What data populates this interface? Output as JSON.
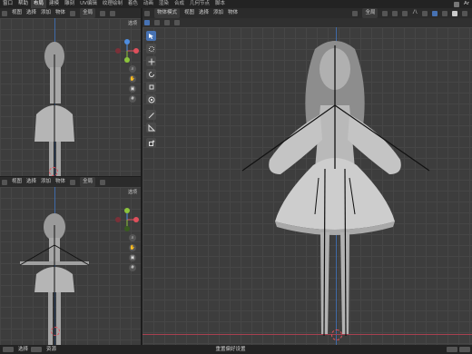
{
  "topbar": {
    "menus": [
      "窗口",
      "帮助"
    ],
    "workspaces": [
      "布局",
      "建模",
      "雕刻",
      "UV编辑",
      "纹理绘制",
      "着色",
      "动画",
      "渲染",
      "合成",
      "几何节点",
      "脚本"
    ],
    "active_workspace": "布局",
    "right_text": "Ar"
  },
  "left_top": {
    "menus": [
      "视图",
      "选择",
      "添加",
      "物体"
    ],
    "transform": "全局",
    "options": "选项"
  },
  "left_bottom": {
    "menus": [
      "视图",
      "选择",
      "添加",
      "物体"
    ],
    "transform": "全局",
    "options": "选项"
  },
  "right": {
    "mode": "物体模式",
    "menus": [
      "视图",
      "选择",
      "添加",
      "物体"
    ],
    "transform": "全局",
    "extra": "八"
  },
  "status": {
    "left": [
      "选择",
      "资源"
    ],
    "center": "重置偏好设置"
  },
  "colors": {
    "x_axis": "#e0505c",
    "y_axis": "#8cc43c",
    "z_axis": "#4f8ee0",
    "active_tool": "#4772b3"
  }
}
